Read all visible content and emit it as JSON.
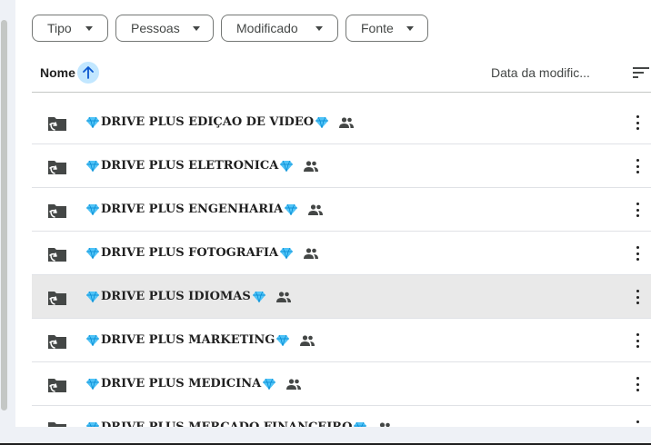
{
  "filters": [
    {
      "label": "Tipo"
    },
    {
      "label": "Pessoas"
    },
    {
      "label": "Modificado"
    },
    {
      "label": "Fonte"
    }
  ],
  "header": {
    "name_label": "Nome",
    "date_label": "Data da modific..."
  },
  "files": [
    {
      "name": "DRIVE PLUS EDIÇAO DE VIDEO",
      "shared": true
    },
    {
      "name": "DRIVE PLUS ELETRONICA",
      "shared": true
    },
    {
      "name": "DRIVE PLUS ENGENHARIA",
      "shared": true
    },
    {
      "name": "DRIVE PLUS FOTOGRAFIA",
      "shared": true
    },
    {
      "name": "DRIVE PLUS IDIOMAS",
      "shared": true
    },
    {
      "name": "DRIVE PLUS MARKETING ",
      "shared": true
    },
    {
      "name": "DRIVE PLUS MEDICINA",
      "shared": true
    },
    {
      "name": "DRIVE PLUS MERCADO FINANCEIRO",
      "shared": true
    }
  ],
  "colors": {
    "sort_active_bg": "#c2e7ff",
    "gem": "#4fc3f7",
    "hover_row": "#e9e9e9"
  },
  "icons": {
    "folder": "shortcut-folder-icon",
    "shared": "people-icon",
    "gem": "gem-icon",
    "more": "more-vert-icon",
    "sort": "arrow-up-icon",
    "sort_options": "sort-lines-icon"
  }
}
